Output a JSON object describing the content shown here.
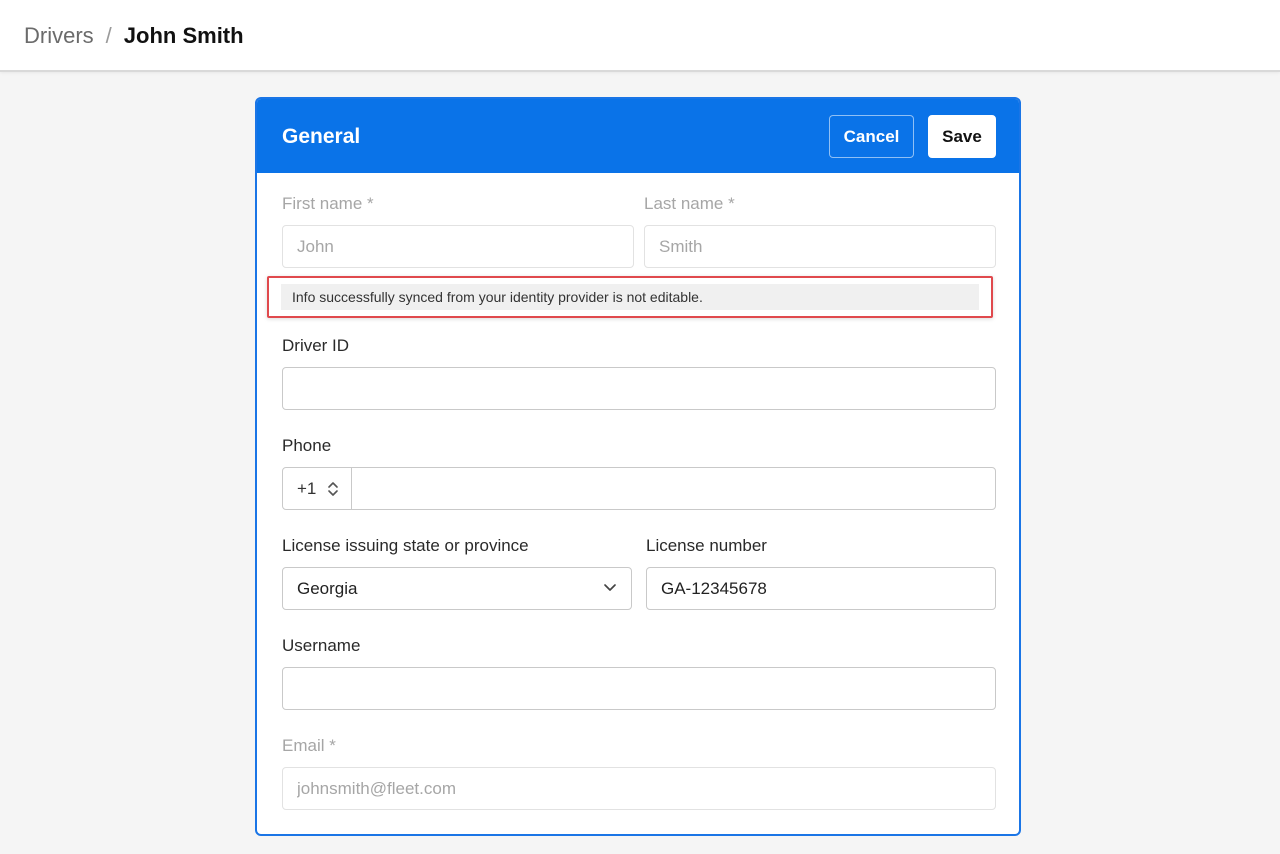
{
  "breadcrumb": {
    "root": "Drivers",
    "separator": "/",
    "current": "John Smith"
  },
  "card": {
    "title": "General",
    "cancel_label": "Cancel",
    "save_label": "Save"
  },
  "form": {
    "first_name": {
      "label": "First name *",
      "value": "John",
      "disabled": true
    },
    "last_name": {
      "label": "Last name *",
      "value": "Smith",
      "disabled": true
    },
    "sync_note": "Info successfully synced from your identity provider is not editable.",
    "driver_id": {
      "label": "Driver ID",
      "value": ""
    },
    "phone": {
      "label": "Phone",
      "country_code": "+1",
      "value": ""
    },
    "license_state": {
      "label": "License issuing state or province",
      "value": "Georgia"
    },
    "license_number": {
      "label": "License number",
      "value": "GA-12345678"
    },
    "username": {
      "label": "Username",
      "value": ""
    },
    "email": {
      "label": "Email *",
      "value": "johnsmith@fleet.com",
      "disabled": true
    }
  },
  "colors": {
    "accent": "#0a73e8",
    "highlight_border": "#e0494d"
  }
}
